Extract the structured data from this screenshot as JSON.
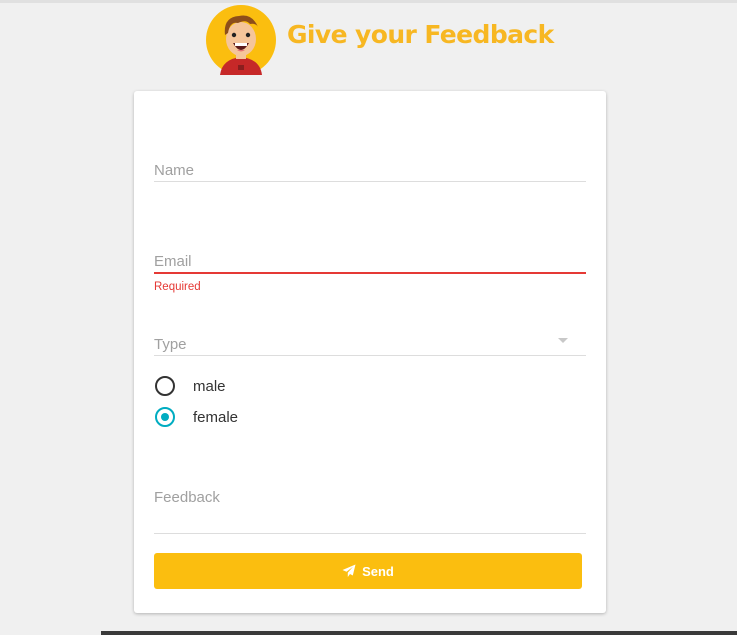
{
  "header": {
    "title": "Give your Feedback",
    "avatar_icon": "cartoon-face-icon"
  },
  "form": {
    "name": {
      "placeholder": "Name",
      "value": ""
    },
    "email": {
      "placeholder": "Email",
      "value": "",
      "error": "Required"
    },
    "type": {
      "placeholder": "Type",
      "value": ""
    },
    "gender": {
      "options": [
        {
          "label": "male",
          "checked": false
        },
        {
          "label": "female",
          "checked": true
        }
      ]
    },
    "feedback": {
      "placeholder": "Feedback",
      "value": ""
    },
    "send_label": "Send",
    "send_icon": "paper-plane-icon"
  },
  "colors": {
    "brand_yellow": "#f7b722",
    "button_yellow": "#fbbe0f",
    "error_red": "#e53935",
    "radio_accent": "#00acc1"
  }
}
